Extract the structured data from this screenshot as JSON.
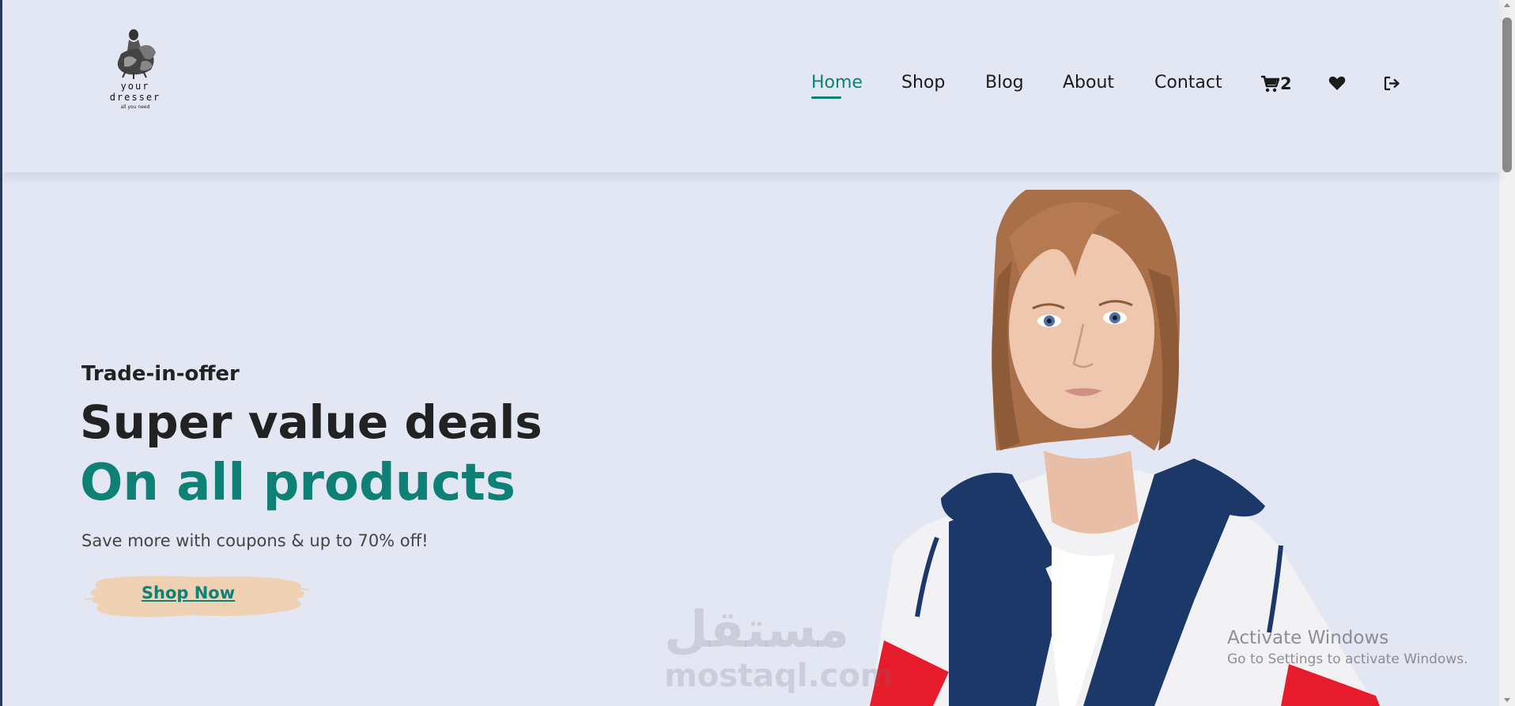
{
  "logo": {
    "name": "your dresser",
    "tagline": "all you need"
  },
  "nav": {
    "items": [
      {
        "label": "Home",
        "active": true
      },
      {
        "label": "Shop",
        "active": false
      },
      {
        "label": "Blog",
        "active": false
      },
      {
        "label": "About",
        "active": false
      },
      {
        "label": "Contact",
        "active": false
      }
    ],
    "cart_count": "2",
    "icons": [
      "cart-icon",
      "heart-icon",
      "sign-out-icon"
    ]
  },
  "hero": {
    "kicker": "Trade-in-offer",
    "title": "Super value deals",
    "title_highlight": "On all products",
    "description": "Save more with coupons & up to 70% off!",
    "cta_label": "Shop Now"
  },
  "watermark": {
    "arabic": "مستقل",
    "latin": "mostaql.com"
  },
  "os_notice": {
    "title": "Activate Windows",
    "subtitle": "Go to Settings to activate Windows."
  },
  "colors": {
    "accent": "#0f8075",
    "background": "#e3e7f3",
    "button_brush": "#efd2b4"
  }
}
